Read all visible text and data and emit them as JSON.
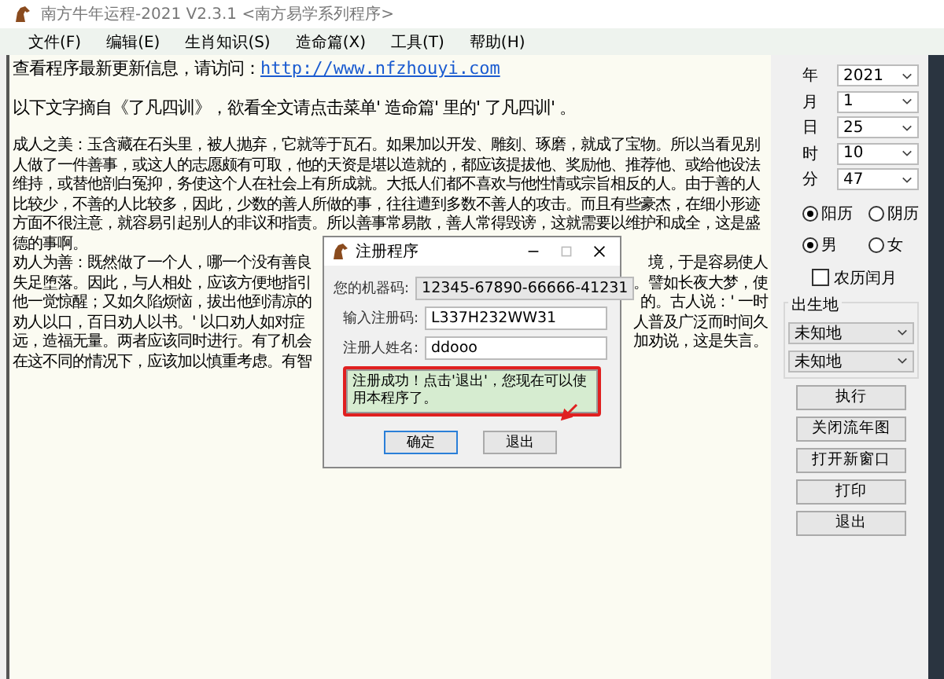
{
  "window": {
    "title": "南方牛年运程-2021  V2.3.1  <南方易学系列程序>"
  },
  "menu": [
    "文件(F)",
    "编辑(E)",
    "生肖知识(S)",
    "造命篇(X)",
    "工具(T)",
    "帮助(H)"
  ],
  "content": {
    "update_text": "查看程序最新更新信息，请访问：",
    "update_link": "http://www.nfzhouyi.com",
    "intro": "以下文字摘自《了凡四训》，欲看全文请点击菜单' 造命篇' 里的' 了凡四训' 。",
    "lines": [
      {
        "left": "成人之美：玉含藏在石头里，被人抛弃，它就等于瓦石。如果加以开发、雕刻、琢磨，就成了宝物。所以当看见别"
      },
      {
        "left": "人做了一件善事，或这人的志愿颇有可取，他的天资是堪以造就的，都应该提拔他、奖励他、推荐他、或给他设法"
      },
      {
        "left": "维持，或替他剖白冤抑，务使这个人在社会上有所成就。大抵人们都不喜欢与他性情或宗旨相反的人。由于善的人"
      },
      {
        "left": "比较少，不善的人比较多，因此，少数的善人所做的事，往往遭到多数不善人的攻击。而且有些豪杰，在细小形迹"
      },
      {
        "left": "方面不很注意，就容易引起别人的非议和指责。所以善事常易散，善人常得毁谤，这就需要以维护和成全，这是盛"
      },
      {
        "left": "德的事啊。"
      },
      {
        "left": "劝人为善：既然做了一个人，哪一个没有善良",
        "right": "境，于是容易使人"
      },
      {
        "left": "失足堕落。因此，与人相处，应该方便地指引",
        "right": "。譬如长夜大梦，使"
      },
      {
        "left": "他一觉惊醒；又如久陷烦恼，拔出他到清凉的",
        "right": "的。古人说：' 一时"
      },
      {
        "left": "劝人以口，百日劝人以书。' 以口劝人如对症",
        "right": "人普及广泛而时间久"
      },
      {
        "left": "远，造福无量。两者应该同时进行。有了机会",
        "right": "加劝说，这是失言。"
      },
      {
        "left": "在这不同的情况下，应该加以慎重考虑。有智"
      }
    ]
  },
  "panel": {
    "date_fields": [
      {
        "label": "年",
        "value": "2021"
      },
      {
        "label": "月",
        "value": "1"
      },
      {
        "label": "日",
        "value": "25"
      },
      {
        "label": "时",
        "value": "10"
      },
      {
        "label": "分",
        "value": "47"
      }
    ],
    "calendar": [
      {
        "label": "阳历",
        "selected": true
      },
      {
        "label": "阴历",
        "selected": false
      }
    ],
    "gender": [
      {
        "label": "男",
        "selected": true
      },
      {
        "label": "女",
        "selected": false
      }
    ],
    "leap_month": {
      "label": "农历闰月",
      "checked": false
    },
    "birthplace": {
      "label": "出生地",
      "selects": [
        "未知地",
        "未知地"
      ]
    },
    "buttons": [
      "执行",
      "关闭流年图",
      "打开新窗口",
      "打印",
      "退出"
    ]
  },
  "dialog": {
    "title": "注册程序",
    "fields": [
      {
        "label": "您的机器码:",
        "value": "12345-67890-66666-41231",
        "disabled": true
      },
      {
        "label": "输入注册码:",
        "value": "L337H232WW31",
        "disabled": false
      },
      {
        "label": "注册人姓名:",
        "value": "ddooo",
        "disabled": false
      }
    ],
    "message": "注册成功！点击'退出'，您现在可以使用本程序了。",
    "buttons": [
      {
        "label": "确定",
        "focused": true
      },
      {
        "label": "退出",
        "focused": false
      }
    ]
  }
}
